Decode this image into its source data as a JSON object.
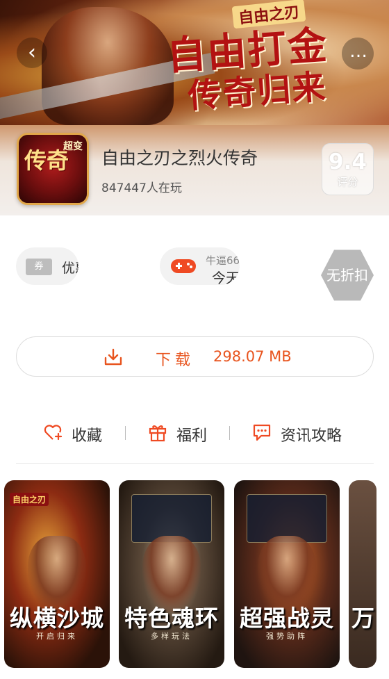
{
  "hero": {
    "logo_text": "自由之刃",
    "slogan_line1": "自由打金",
    "slogan_line2": "传奇归来",
    "back_icon": "‹",
    "more_icon": "…"
  },
  "game": {
    "icon_main": "传奇",
    "icon_tag": "超变",
    "title": "自由之刃之烈火传奇",
    "players": "847447人在玩",
    "score": "9.4",
    "score_label": "评分"
  },
  "chips": {
    "coupon_icon_text": "券",
    "coupon_label": "优惠",
    "game_sub": "牛逼66",
    "game_main": "今天",
    "discount": "无折扣"
  },
  "download": {
    "label": "下载",
    "size": "298.07 MB",
    "accent": "#e8541e"
  },
  "actions": [
    {
      "label": "收藏",
      "icon": "heart-plus-icon"
    },
    {
      "label": "福利",
      "icon": "gift-icon"
    },
    {
      "label": "资讯攻略",
      "icon": "chat-bubble-icon"
    }
  ],
  "screenshots": [
    {
      "title": "纵横沙城",
      "subtitle": "开启归来",
      "logo": "自由之刃"
    },
    {
      "title": "特色魂环",
      "subtitle": "多样玩法",
      "logo": ""
    },
    {
      "title": "超强战灵",
      "subtitle": "强势助阵",
      "logo": ""
    },
    {
      "title": "万",
      "subtitle": "",
      "logo": ""
    }
  ]
}
